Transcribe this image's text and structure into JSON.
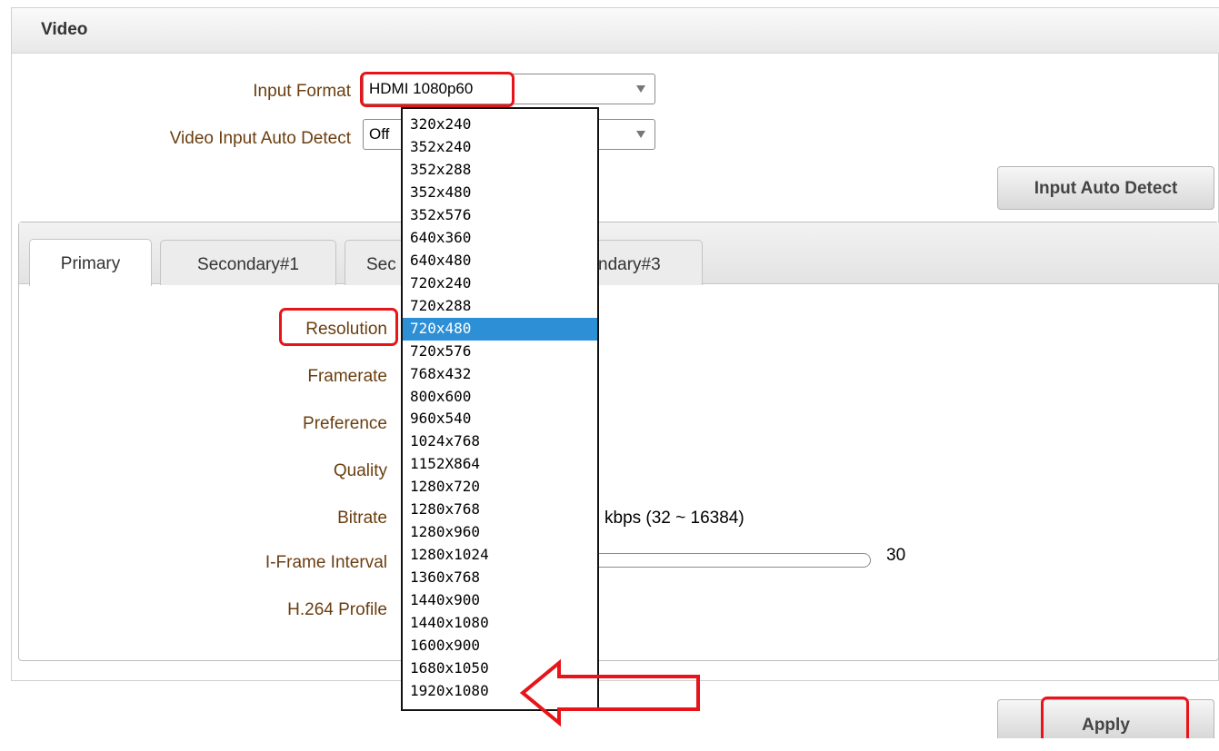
{
  "section": {
    "title": "Video"
  },
  "input_format": {
    "label": "Input Format",
    "value": "HDMI 1080p60"
  },
  "auto_detect_select": {
    "label": "Video Input Auto Detect",
    "value": "Off"
  },
  "buttons": {
    "input_auto_detect": "Input Auto Detect",
    "apply": "Apply"
  },
  "tabs": [
    {
      "label": "Primary"
    },
    {
      "label": "Secondary#1"
    },
    {
      "label": "Sec"
    },
    {
      "label": "ndary#3"
    }
  ],
  "fields": {
    "resolution": "Resolution",
    "framerate": "Framerate",
    "preference": "Preference",
    "quality": "Quality",
    "bitrate": "Bitrate",
    "bitrate_unit": "kbps (32 ~ 16384)",
    "iframe": "I-Frame Interval",
    "iframe_value": "30",
    "h264": "H.264 Profile"
  },
  "resolution_options": [
    "320x240",
    "352x240",
    "352x288",
    "352x480",
    "352x576",
    "640x360",
    "640x480",
    "720x240",
    "720x288",
    "720x480",
    "720x576",
    "768x432",
    "800x600",
    "960x540",
    "1024x768",
    "1152X864",
    "1280x720",
    "1280x768",
    "1280x960",
    "1280x1024",
    "1360x768",
    "1440x900",
    "1440x1080",
    "1600x900",
    "1680x1050",
    "1920x1080"
  ],
  "resolution_selected_index": 9,
  "colors": {
    "accent_selected": "#2d8fd6",
    "callout": "#e8141a",
    "label": "#6b3e10"
  }
}
